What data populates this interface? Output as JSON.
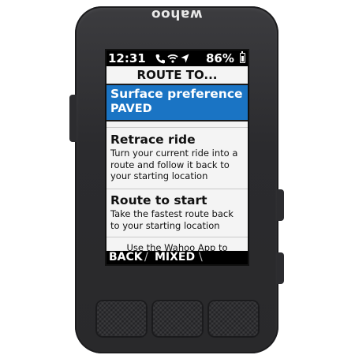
{
  "device": {
    "brand_logo": "wahoo"
  },
  "statusbar": {
    "time": "12:31",
    "icons": [
      "phone-icon",
      "wifi-icon",
      "location-arrow-icon"
    ],
    "battery_text": "86%",
    "battery_level": 0.86
  },
  "menu": {
    "title": "ROUTE TO...",
    "items": [
      {
        "title": "Surface preference",
        "subtitle": "PAVED",
        "selected": true
      },
      {
        "title": "Retrace ride",
        "subtitle": "Turn your current ride into a route and follow it back to your starting location",
        "selected": false
      },
      {
        "title": "Route to start",
        "subtitle": "Take the fastest route back to your starting location",
        "selected": false
      }
    ],
    "footer_note": "Use the Wahoo App to"
  },
  "bottombar": {
    "back_label": "BACK",
    "separator": "/",
    "mixed_label": "MIXED",
    "separator2": "\\"
  },
  "colors": {
    "selected_bg": "#1a74c4",
    "screen_bg": "#f4f4f4",
    "device_body": "#2b2b2e"
  }
}
